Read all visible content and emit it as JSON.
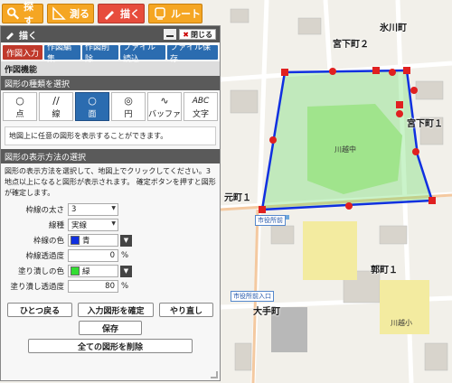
{
  "toolbar": {
    "search": "探す",
    "measure": "測る",
    "draw": "描く",
    "route": "ルート"
  },
  "panel": {
    "title": "描く",
    "close": "閉じる",
    "tabs": [
      "作図入力",
      "作図編集",
      "作図削除",
      "ファイル読込",
      "ファイル保存"
    ],
    "function_heading": "作図機能",
    "shape_heading": "図形の種類を選択",
    "shapes": [
      {
        "label": "点",
        "icon": "○"
      },
      {
        "label": "線",
        "icon": "∕∕"
      },
      {
        "label": "面",
        "icon": "○"
      },
      {
        "label": "円",
        "icon": "◎"
      },
      {
        "label": "バッファ",
        "icon": "∿"
      },
      {
        "label": "文字",
        "icon": "ABC"
      }
    ],
    "selected_shape": "面",
    "description": "地図上に任意の図形を表示することができます。",
    "method_heading": "図形の表示方法の選択",
    "instruction": "図形の表示方法を選択して、地図上でクリックしてください。3地点以上になると図形が表示されます。 確定ボタンを押すと図形が確定します。",
    "line_width_label": "枠線の太さ",
    "line_width_value": "3",
    "line_type_label": "線種",
    "line_type_value": "実線",
    "line_color_label": "枠線の色",
    "line_color_name": "青",
    "line_color": "#1030e0",
    "line_opacity_label": "枠線透過度",
    "line_opacity_value": "0",
    "fill_color_label": "塗り潰しの色",
    "fill_color_name": "緑",
    "fill_color": "#33dd33",
    "fill_opacity_label": "塗り潰し透過度",
    "fill_opacity_value": "80",
    "percent": "%",
    "undo": "ひとつ戻る",
    "confirm": "入力図形を確定",
    "redo": "やり直し",
    "save": "保存",
    "delete_all": "全ての図形を削除"
  },
  "map": {
    "labels": {
      "hikawa": "氷川町",
      "miyashita1": "宮下町１",
      "miyashita2": "宮下町２",
      "motomachi1": "元町１",
      "shiyakusho": "市役所前",
      "kawagoe_naka": "川越中",
      "ohte": "大手町",
      "ishibashi": "市役所前入口",
      "isshiki": "郭町１",
      "kawagoe_ele": "川越小"
    },
    "accent_polygon": "#1030e0",
    "vertex_color": "#e02020"
  }
}
